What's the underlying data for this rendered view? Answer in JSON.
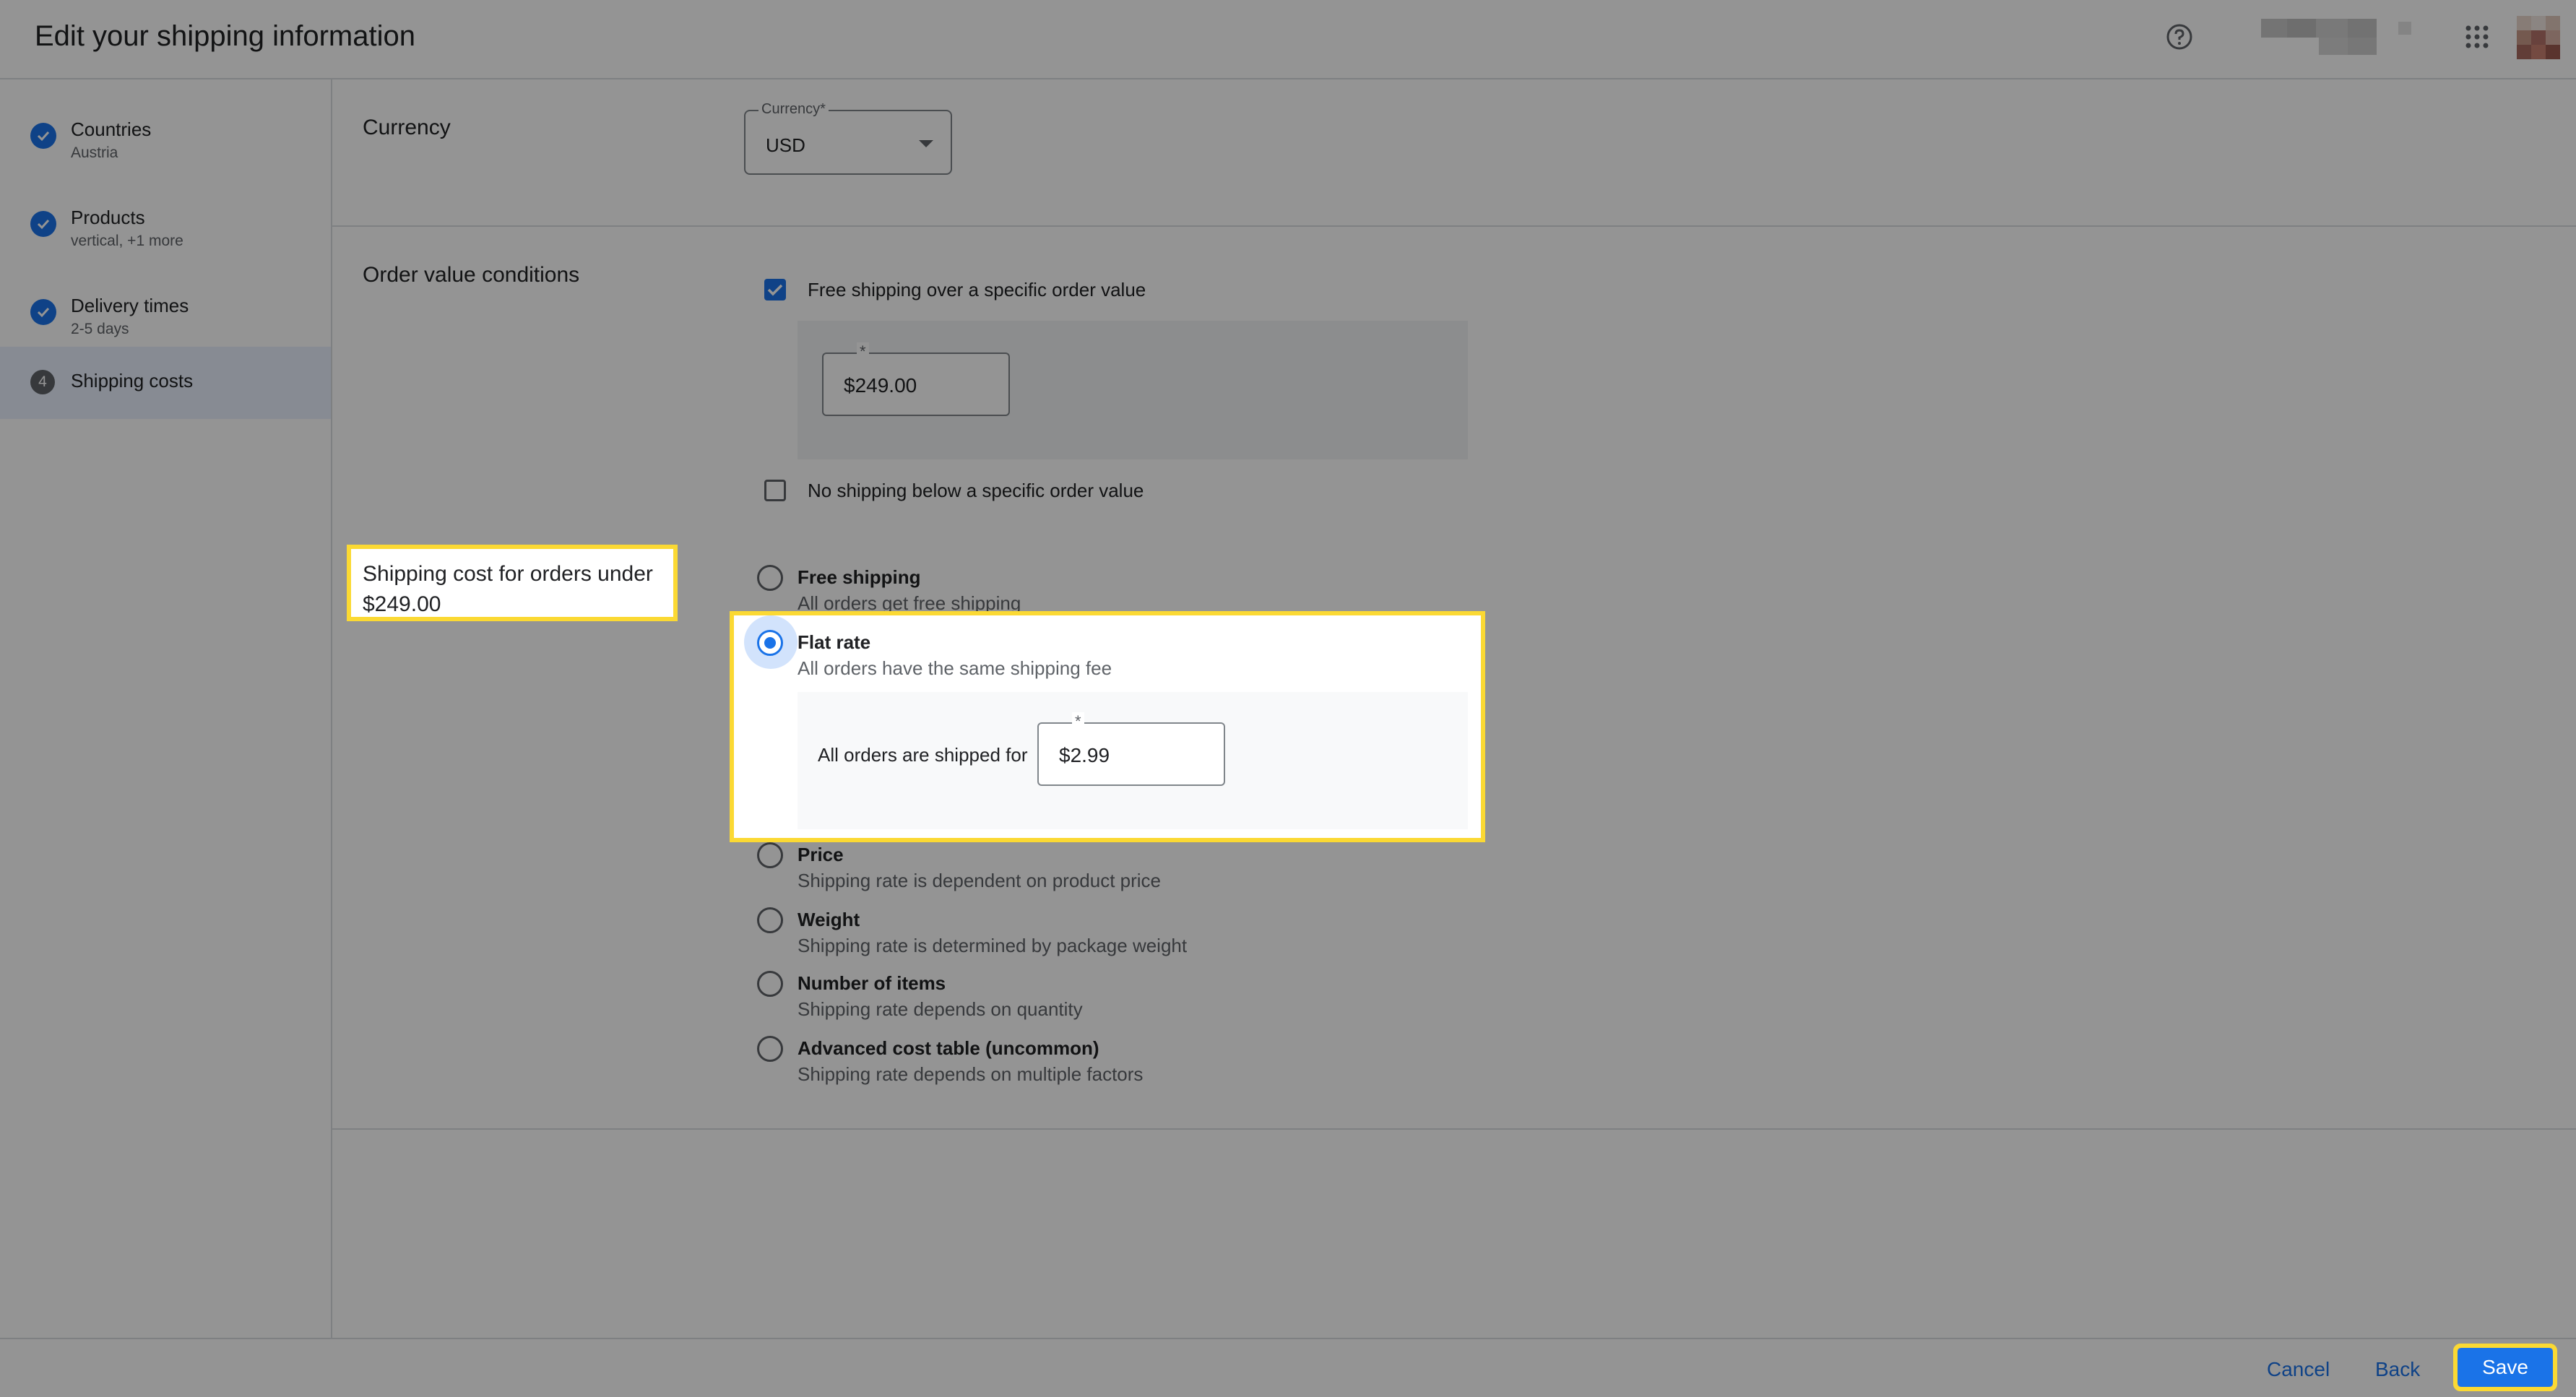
{
  "header": {
    "title": "Edit your shipping information"
  },
  "icons": {
    "help": "help-circle-icon",
    "apps": "apps-grid-icon",
    "avatar": "avatar",
    "check": "check-icon",
    "caret": "caret-down-icon"
  },
  "steps": [
    {
      "title": "Countries",
      "sub": "Austria",
      "done": true
    },
    {
      "title": "Products",
      "sub": "vertical, +1 more",
      "done": true
    },
    {
      "title": "Delivery times",
      "sub": "2-5 days",
      "done": true
    },
    {
      "title": "Shipping costs",
      "number": "4",
      "active": true
    }
  ],
  "currency": {
    "section_label": "Currency",
    "field_label": "Currency*",
    "value": "USD"
  },
  "order_value": {
    "section_label": "Order value conditions",
    "free_over": {
      "label": "Free shipping over a specific order value",
      "checked": true,
      "field_label": "*",
      "value": "$249.00"
    },
    "no_below": {
      "label": "No shipping below a specific order value",
      "checked": false
    }
  },
  "shipping_cost": {
    "section_label": "Shipping cost for orders under $249.00",
    "options": [
      {
        "title": "Free shipping",
        "sub": "All orders get free shipping",
        "selected": false
      },
      {
        "title": "Flat rate",
        "sub": "All orders have the same shipping fee",
        "selected": true
      },
      {
        "title": "Price",
        "sub": "Shipping rate is dependent on product price",
        "selected": false
      },
      {
        "title": "Weight",
        "sub": "Shipping rate is determined by package weight",
        "selected": false
      },
      {
        "title": "Number of items",
        "sub": "Shipping rate depends on quantity",
        "selected": false
      },
      {
        "title": "Advanced cost table (uncommon)",
        "sub": "Shipping rate depends on multiple factors",
        "selected": false
      }
    ],
    "flat_rate": {
      "label": "All orders are shipped for",
      "field_label": "*",
      "value": "$2.99"
    }
  },
  "footer": {
    "cancel": "Cancel",
    "back": "Back",
    "save": "Save"
  },
  "colors": {
    "accent": "#1a73e8",
    "highlight": "#fbd933"
  }
}
